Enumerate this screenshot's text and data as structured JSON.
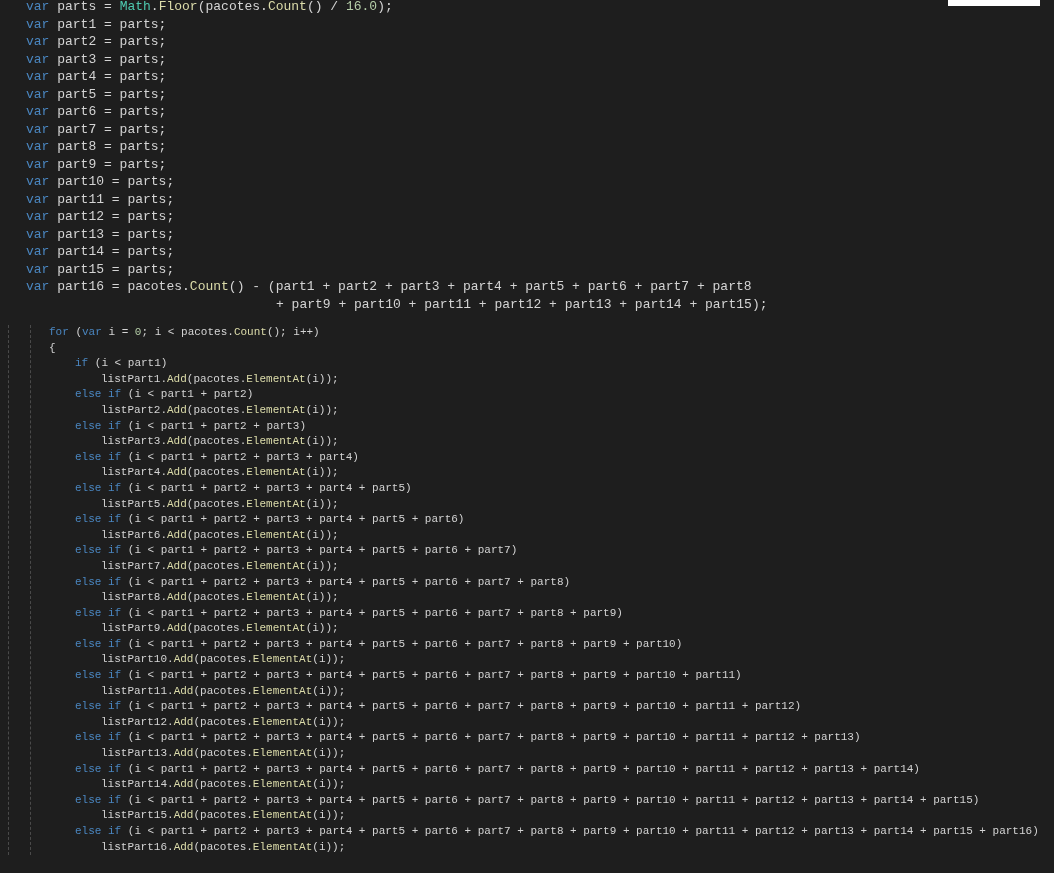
{
  "declarations": [
    {
      "kind": "line",
      "tokens": [
        {
          "kind": "keyword",
          "t": "var"
        },
        {
          "kind": "plain",
          "t": " parts = "
        },
        {
          "kind": "type",
          "t": "Math"
        },
        {
          "kind": "plain",
          "t": "."
        },
        {
          "kind": "method",
          "t": "Floor"
        },
        {
          "kind": "plain",
          "t": "(pacotes."
        },
        {
          "kind": "method",
          "t": "Count"
        },
        {
          "kind": "plain",
          "t": "() / "
        },
        {
          "kind": "number",
          "t": "16.0"
        },
        {
          "kind": "plain",
          "t": ");"
        }
      ]
    },
    {
      "kind": "line",
      "tokens": [
        {
          "kind": "keyword",
          "t": "var"
        },
        {
          "kind": "plain",
          "t": " part1 = parts;"
        }
      ]
    },
    {
      "kind": "line",
      "tokens": [
        {
          "kind": "keyword",
          "t": "var"
        },
        {
          "kind": "plain",
          "t": " part2 = parts;"
        }
      ]
    },
    {
      "kind": "line",
      "tokens": [
        {
          "kind": "keyword",
          "t": "var"
        },
        {
          "kind": "plain",
          "t": " part3 = parts;"
        }
      ]
    },
    {
      "kind": "line",
      "tokens": [
        {
          "kind": "keyword",
          "t": "var"
        },
        {
          "kind": "plain",
          "t": " part4 = parts;"
        }
      ]
    },
    {
      "kind": "line",
      "tokens": [
        {
          "kind": "keyword",
          "t": "var"
        },
        {
          "kind": "plain",
          "t": " part5 = parts;"
        }
      ]
    },
    {
      "kind": "line",
      "tokens": [
        {
          "kind": "keyword",
          "t": "var"
        },
        {
          "kind": "plain",
          "t": " part6 = parts;"
        }
      ]
    },
    {
      "kind": "line",
      "tokens": [
        {
          "kind": "keyword",
          "t": "var"
        },
        {
          "kind": "plain",
          "t": " part7 = parts;"
        }
      ]
    },
    {
      "kind": "line",
      "tokens": [
        {
          "kind": "keyword",
          "t": "var"
        },
        {
          "kind": "plain",
          "t": " part8 = parts;"
        }
      ]
    },
    {
      "kind": "line",
      "tokens": [
        {
          "kind": "keyword",
          "t": "var"
        },
        {
          "kind": "plain",
          "t": " part9 = parts;"
        }
      ]
    },
    {
      "kind": "line",
      "tokens": [
        {
          "kind": "keyword",
          "t": "var"
        },
        {
          "kind": "plain",
          "t": " part10 = parts;"
        }
      ]
    },
    {
      "kind": "line",
      "tokens": [
        {
          "kind": "keyword",
          "t": "var"
        },
        {
          "kind": "plain",
          "t": " part11 = parts;"
        }
      ]
    },
    {
      "kind": "line",
      "tokens": [
        {
          "kind": "keyword",
          "t": "var"
        },
        {
          "kind": "plain",
          "t": " part12 = parts;"
        }
      ]
    },
    {
      "kind": "line",
      "tokens": [
        {
          "kind": "keyword",
          "t": "var"
        },
        {
          "kind": "plain",
          "t": " part13 = parts;"
        }
      ]
    },
    {
      "kind": "line",
      "tokens": [
        {
          "kind": "keyword",
          "t": "var"
        },
        {
          "kind": "plain",
          "t": " part14 = parts;"
        }
      ]
    },
    {
      "kind": "line",
      "tokens": [
        {
          "kind": "keyword",
          "t": "var"
        },
        {
          "kind": "plain",
          "t": " part15 = parts;"
        }
      ]
    },
    {
      "kind": "line",
      "tokens": [
        {
          "kind": "keyword",
          "t": "var"
        },
        {
          "kind": "plain",
          "t": " part16 = pacotes."
        },
        {
          "kind": "method",
          "t": "Count"
        },
        {
          "kind": "plain",
          "t": "() - (part1 + part2 + part3 + part4 + part5 + part6 + part7 + part8"
        }
      ]
    },
    {
      "kind": "continuation",
      "tokens": [
        {
          "kind": "plain",
          "t": "+ part9 + part10 + part11 + part12 + part13 + part14 + part15);"
        }
      ]
    }
  ],
  "loop": {
    "header": [
      {
        "kind": "keyword",
        "t": "for"
      },
      {
        "kind": "plain",
        "t": " ("
      },
      {
        "kind": "keyword",
        "t": "var"
      },
      {
        "kind": "plain",
        "t": " i = "
      },
      {
        "kind": "number",
        "t": "0"
      },
      {
        "kind": "plain",
        "t": "; i < pacotes."
      },
      {
        "kind": "method",
        "t": "Count"
      },
      {
        "kind": "plain",
        "t": "(); i++)"
      }
    ],
    "open_brace": "{",
    "branches": [
      {
        "keyword": "if",
        "condition": " (i < part1)",
        "target": "listPart1.",
        "add": "Add",
        "arg": "(pacotes.",
        "element": "ElementAt",
        "tail": "(i));"
      },
      {
        "keyword": "else if",
        "condition": " (i < part1 + part2)",
        "target": "listPart2.",
        "add": "Add",
        "arg": "(pacotes.",
        "element": "ElementAt",
        "tail": "(i));"
      },
      {
        "keyword": "else if",
        "condition": " (i < part1 + part2 + part3)",
        "target": "listPart3.",
        "add": "Add",
        "arg": "(pacotes.",
        "element": "ElementAt",
        "tail": "(i));"
      },
      {
        "keyword": "else if",
        "condition": " (i < part1 + part2 + part3 + part4)",
        "target": "listPart4.",
        "add": "Add",
        "arg": "(pacotes.",
        "element": "ElementAt",
        "tail": "(i));"
      },
      {
        "keyword": "else if",
        "condition": " (i < part1 + part2 + part3 + part4 + part5)",
        "target": "listPart5.",
        "add": "Add",
        "arg": "(pacotes.",
        "element": "ElementAt",
        "tail": "(i));"
      },
      {
        "keyword": "else if",
        "condition": " (i < part1 + part2 + part3 + part4 + part5 + part6)",
        "target": "listPart6.",
        "add": "Add",
        "arg": "(pacotes.",
        "element": "ElementAt",
        "tail": "(i));"
      },
      {
        "keyword": "else if",
        "condition": " (i < part1 + part2 + part3 + part4 + part5 + part6 + part7)",
        "target": "listPart7.",
        "add": "Add",
        "arg": "(pacotes.",
        "element": "ElementAt",
        "tail": "(i));"
      },
      {
        "keyword": "else if",
        "condition": " (i < part1 + part2 + part3 + part4 + part5 + part6 + part7 + part8)",
        "target": "listPart8.",
        "add": "Add",
        "arg": "(pacotes.",
        "element": "ElementAt",
        "tail": "(i));"
      },
      {
        "keyword": "else if",
        "condition": " (i < part1 + part2 + part3 + part4 + part5 + part6 + part7 + part8 + part9)",
        "target": "listPart9.",
        "add": "Add",
        "arg": "(pacotes.",
        "element": "ElementAt",
        "tail": "(i));"
      },
      {
        "keyword": "else if",
        "condition": " (i < part1 + part2 + part3 + part4 + part5 + part6 + part7 + part8 + part9 + part10)",
        "target": "listPart10.",
        "add": "Add",
        "arg": "(pacotes.",
        "element": "ElementAt",
        "tail": "(i));"
      },
      {
        "keyword": "else if",
        "condition": " (i < part1 + part2 + part3 + part4 + part5 + part6 + part7 + part8 + part9 + part10 + part11)",
        "target": "listPart11.",
        "add": "Add",
        "arg": "(pacotes.",
        "element": "ElementAt",
        "tail": "(i));"
      },
      {
        "keyword": "else if",
        "condition": " (i < part1 + part2 + part3 + part4 + part5 + part6 + part7 + part8 + part9 + part10 + part11 + part12)",
        "target": "listPart12.",
        "add": "Add",
        "arg": "(pacotes.",
        "element": "ElementAt",
        "tail": "(i));"
      },
      {
        "keyword": "else if",
        "condition": " (i < part1 + part2 + part3 + part4 + part5 + part6 + part7 + part8 + part9 + part10 + part11 + part12 + part13)",
        "target": "listPart13.",
        "add": "Add",
        "arg": "(pacotes.",
        "element": "ElementAt",
        "tail": "(i));"
      },
      {
        "keyword": "else if",
        "condition": " (i < part1 + part2 + part3 + part4 + part5 + part6 + part7 + part8 + part9 + part10 + part11 + part12 + part13 + part14)",
        "target": "listPart14.",
        "add": "Add",
        "arg": "(pacotes.",
        "element": "ElementAt",
        "tail": "(i));"
      },
      {
        "keyword": "else if",
        "condition": " (i < part1 + part2 + part3 + part4 + part5 + part6 + part7 + part8 + part9 + part10 + part11 + part12 + part13 + part14 + part15)",
        "target": "listPart15.",
        "add": "Add",
        "arg": "(pacotes.",
        "element": "ElementAt",
        "tail": "(i));"
      },
      {
        "keyword": "else if",
        "condition": " (i < part1 + part2 + part3 + part4 + part5 + part6 + part7 + part8 + part9 + part10 + part11 + part12 + part13 + part14 + part15 + part16)",
        "target": "listPart16.",
        "add": "Add",
        "arg": "(pacotes.",
        "element": "ElementAt",
        "tail": "(i));"
      }
    ]
  }
}
